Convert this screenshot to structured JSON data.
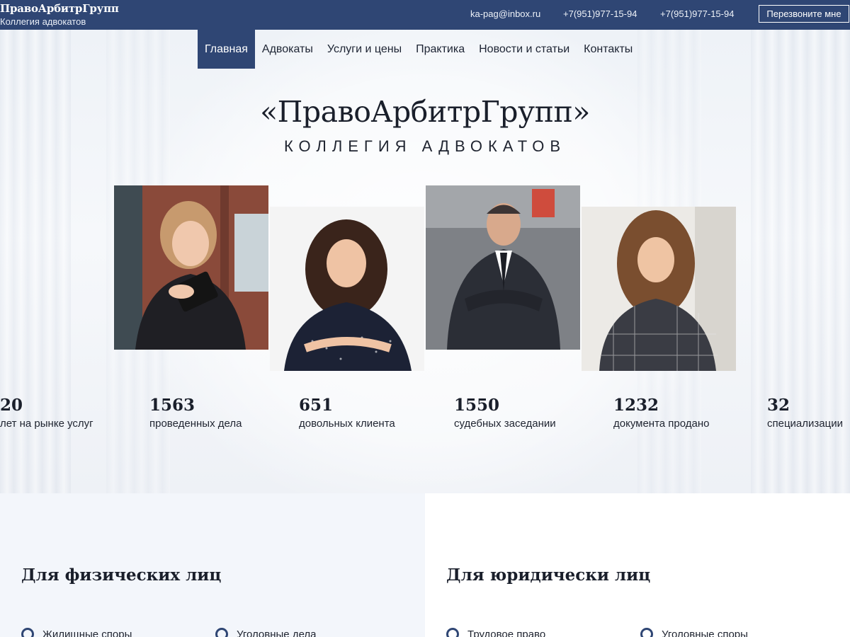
{
  "header": {
    "brand_name": "ПравоАрбитрГрупп",
    "brand_sub": "Коллегия адвокатов",
    "email": "ka-pag@inbox.ru",
    "phone_1": "+7(951)977-15-94",
    "phone_2": "+7(951)977-15-94",
    "callback_label": "Перезвоните мне"
  },
  "nav": {
    "items": [
      {
        "label": "Главная",
        "active": true
      },
      {
        "label": "Адвокаты"
      },
      {
        "label": "Услуги и цены"
      },
      {
        "label": "Практика"
      },
      {
        "label": "Новости и статьи"
      },
      {
        "label": "Контакты"
      }
    ]
  },
  "hero": {
    "title": "«ПравоАрбитрГрупп»",
    "subtitle": "КОЛЛЕГИЯ АДВОКАТОВ"
  },
  "stats": [
    {
      "value": "20",
      "label": "лет на рынке услуг"
    },
    {
      "value": "1563",
      "label": "проведенных дела"
    },
    {
      "value": "651",
      "label": "довольных клиента"
    },
    {
      "value": "1550",
      "label": "судебных заседании"
    },
    {
      "value": "1232",
      "label": "документа продано"
    },
    {
      "value": "32",
      "label": "специализации"
    }
  ],
  "services": {
    "individuals": {
      "title": "Для физических лиц",
      "items": [
        "Жилищные споры",
        "Уголовные дела"
      ]
    },
    "companies": {
      "title": "Для юридически лиц",
      "items": [
        "Трудовое право",
        "Уголовные споры"
      ]
    }
  },
  "colors": {
    "brand": "#2f4674",
    "text": "#1f2430",
    "panel_bg": "#f3f6fb"
  }
}
